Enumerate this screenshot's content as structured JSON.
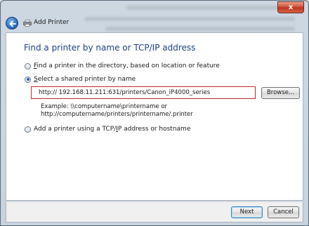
{
  "window": {
    "title": "Add Printer",
    "close_label": "x"
  },
  "page": {
    "heading": "Find a printer by name or TCP/IP address"
  },
  "options": [
    {
      "accel": "F",
      "rest": "ind a printer in the directory, based on location or feature",
      "selected": false
    },
    {
      "accel": "S",
      "rest": "elect a shared printer by name",
      "selected": true
    },
    {
      "pre": "Add a printer using a TCP/",
      "accel": "I",
      "rest": "P address or hostname",
      "selected": false
    }
  ],
  "shared_printer": {
    "value": "http:// 192.168.11.211:631/printers/Canon_iP4000_series",
    "browse_label": "Browse...",
    "example_line1": "Example: \\\\computername\\printername or",
    "example_line2": "http://computername/printers/printername/.printer"
  },
  "footer": {
    "next_label": "Next",
    "cancel_label": "Cancel"
  },
  "icons": {
    "back": "back-arrow-icon",
    "printer": "printer-icon"
  }
}
